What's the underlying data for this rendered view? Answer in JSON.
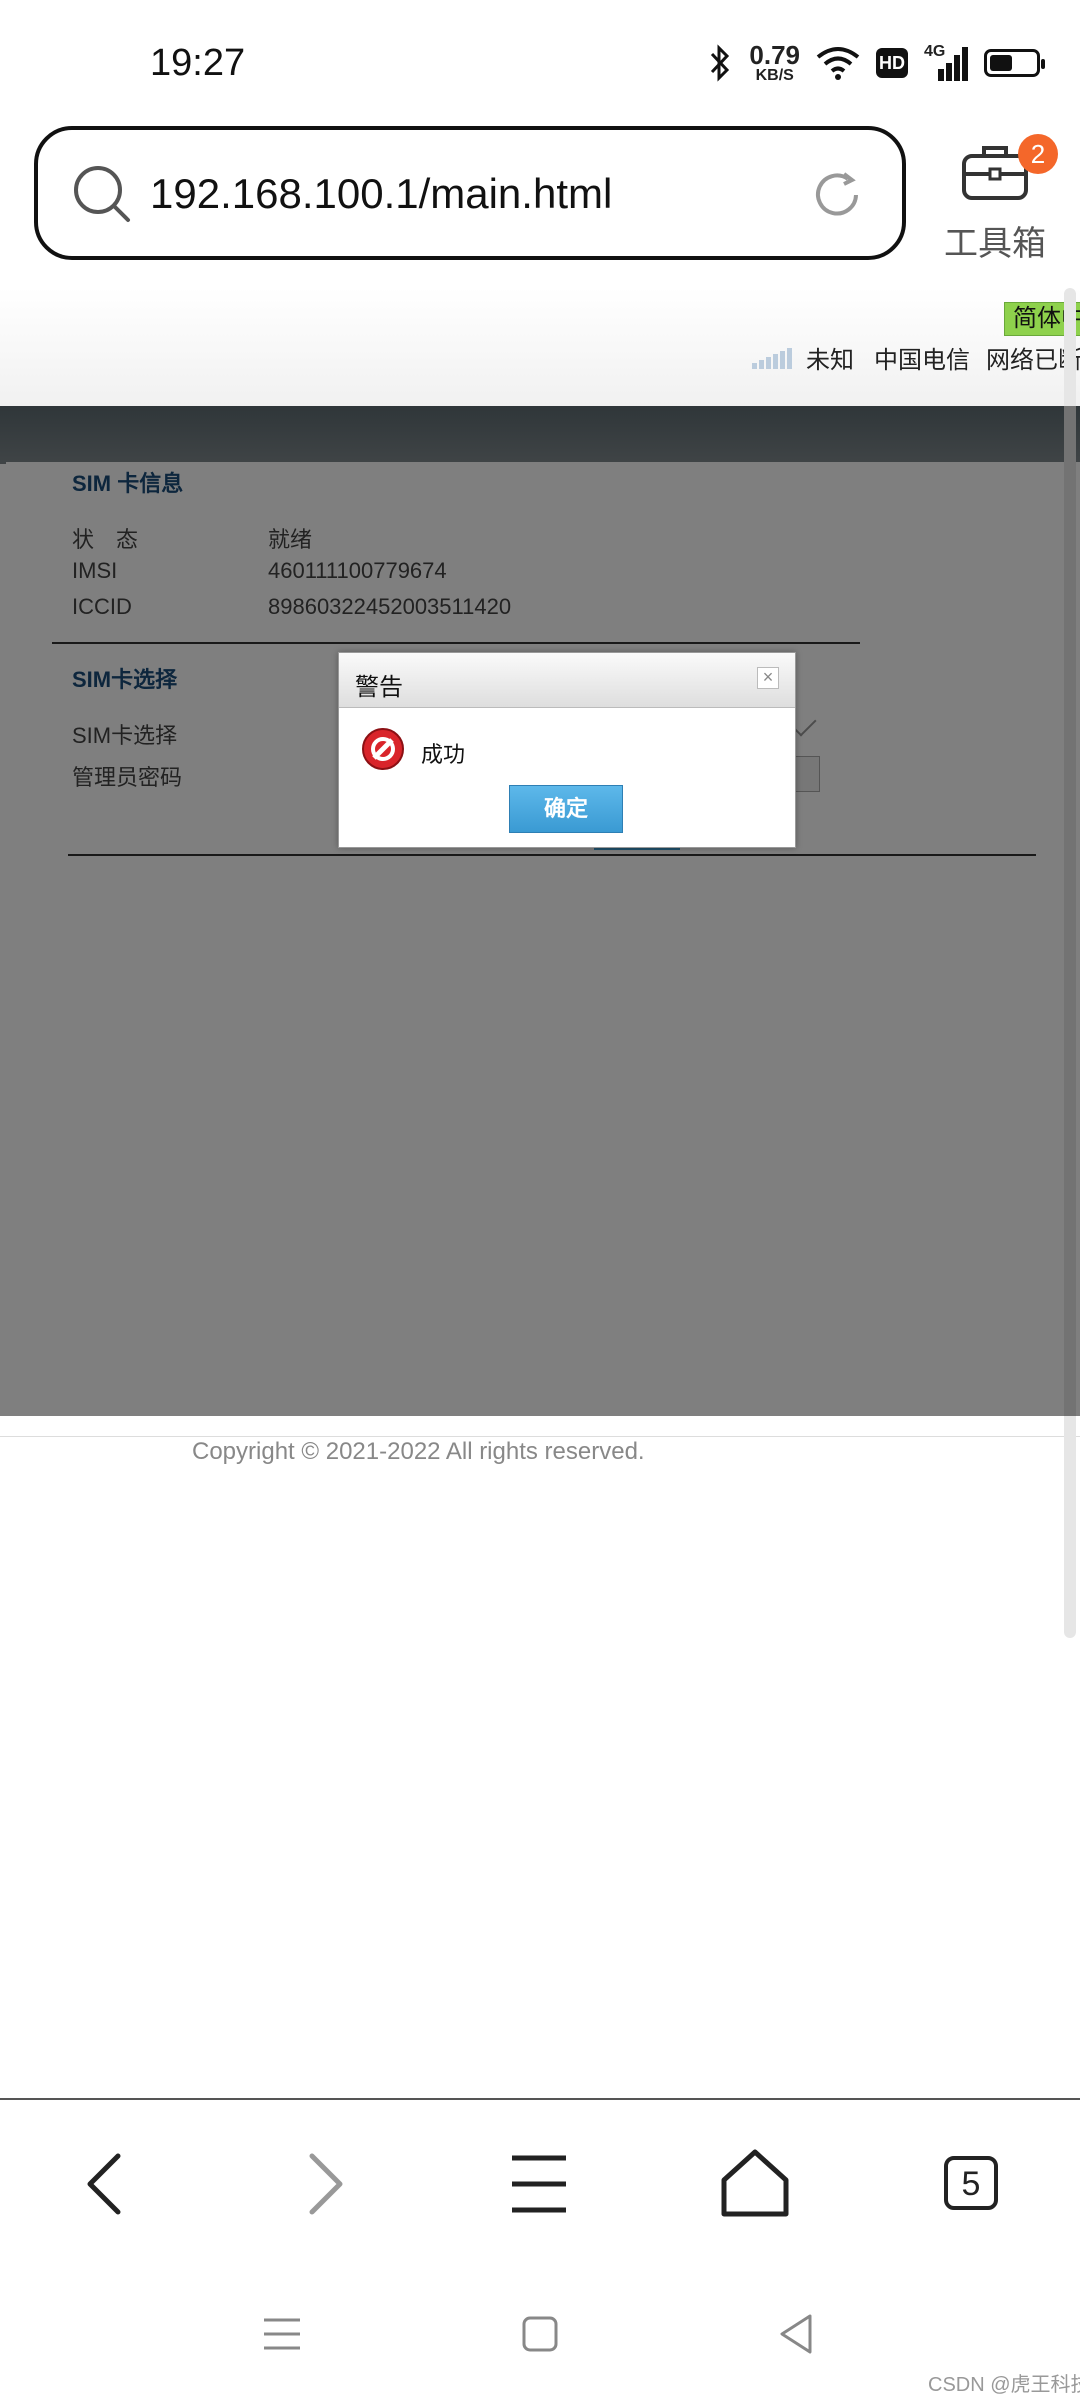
{
  "status_bar": {
    "time": "19:27",
    "net_speed_value": "0.79",
    "net_speed_unit": "KB/S",
    "hd_label": "HD",
    "network_type": "4G",
    "battery_level": 0.5
  },
  "browser": {
    "url": "192.168.100.1/main.html",
    "toolbox_label": "工具箱",
    "toolbox_badge": "2",
    "tab_count": "5"
  },
  "router_page": {
    "language_button": "简体中",
    "signal_text": "未知",
    "carrier": "中国电信",
    "network_state": "网络已断",
    "sim_info": {
      "title": "SIM 卡信息",
      "rows": [
        {
          "label": "状　态",
          "value": "就绪"
        },
        {
          "label": "IMSI",
          "value": "460111100779674"
        },
        {
          "label": "ICCID",
          "value": "89860322452003511420"
        }
      ]
    },
    "sim_select": {
      "title": "SIM卡选择",
      "select_label": "SIM卡选择",
      "password_label": "管理员密码"
    },
    "copyright": "Copyright © 2021-2022 All rights reserved."
  },
  "dialog": {
    "title": "警告",
    "close_symbol": "×",
    "message": "成功",
    "ok_label": "确定"
  },
  "watermark": "CSDN @虎王科技",
  "colors": {
    "badge": "#f4672a",
    "lang_button": "#8ed14c",
    "section_title": "#1a4d7a",
    "ok_button": "#3a9ad3"
  }
}
